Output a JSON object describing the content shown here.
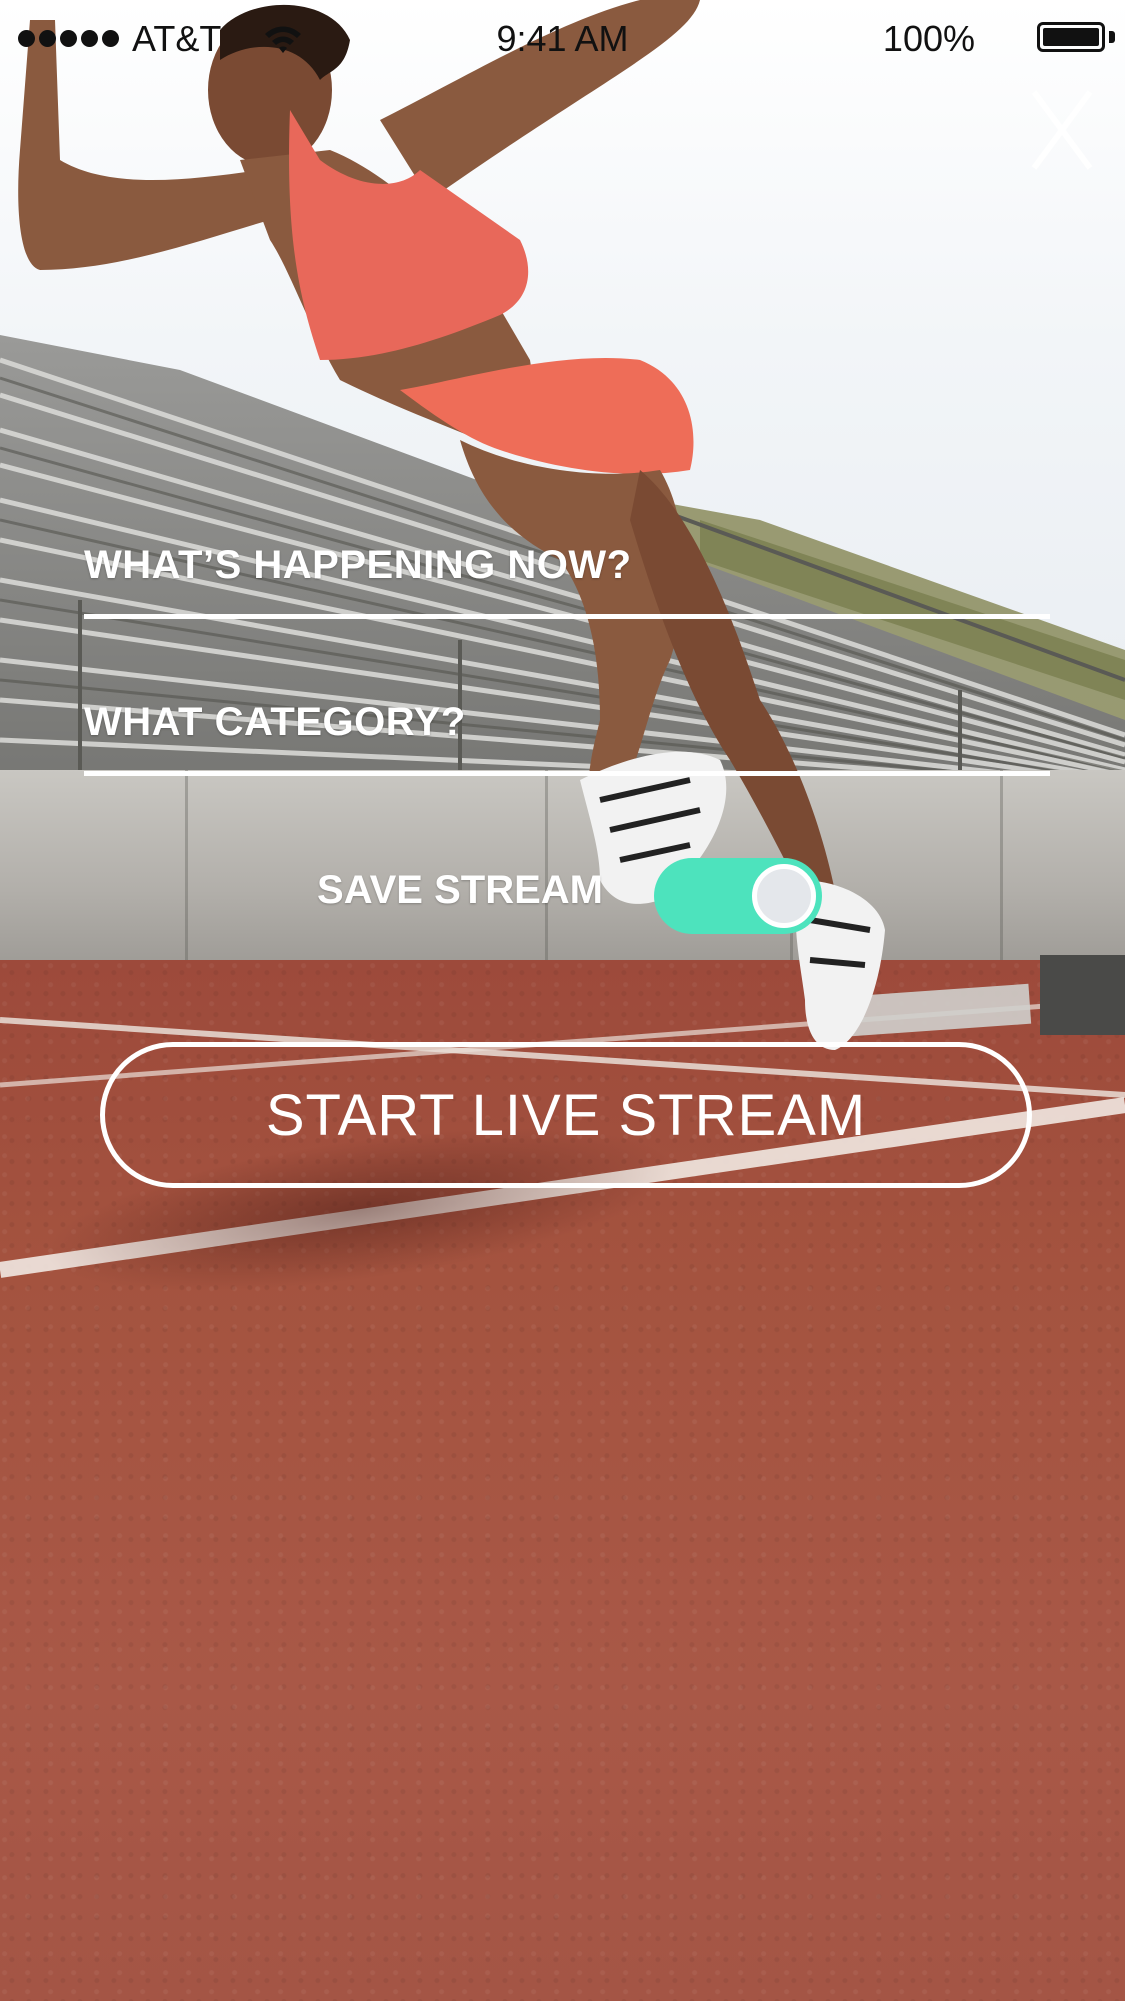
{
  "status_bar": {
    "carrier": "AT&T",
    "time": "9:41 AM",
    "battery_percent": "100%",
    "signal_bars": 5,
    "battery_level": 1.0
  },
  "header": {
    "close_label": "X"
  },
  "form": {
    "happening_label": "WHAT’S HAPPENING NOW?",
    "category_label": "WHAT CATEGORY?",
    "save_stream_label": "SAVE STREAM",
    "save_stream_on": true,
    "start_button_label": "START LIVE STREAM"
  },
  "colors": {
    "accent": "#4de3bd",
    "track": "#a55543",
    "text": "#ffffff"
  },
  "icons": {
    "close": "close-icon",
    "wifi": "wifi-icon",
    "battery": "battery-icon",
    "signal": "signal-dots-icon"
  }
}
